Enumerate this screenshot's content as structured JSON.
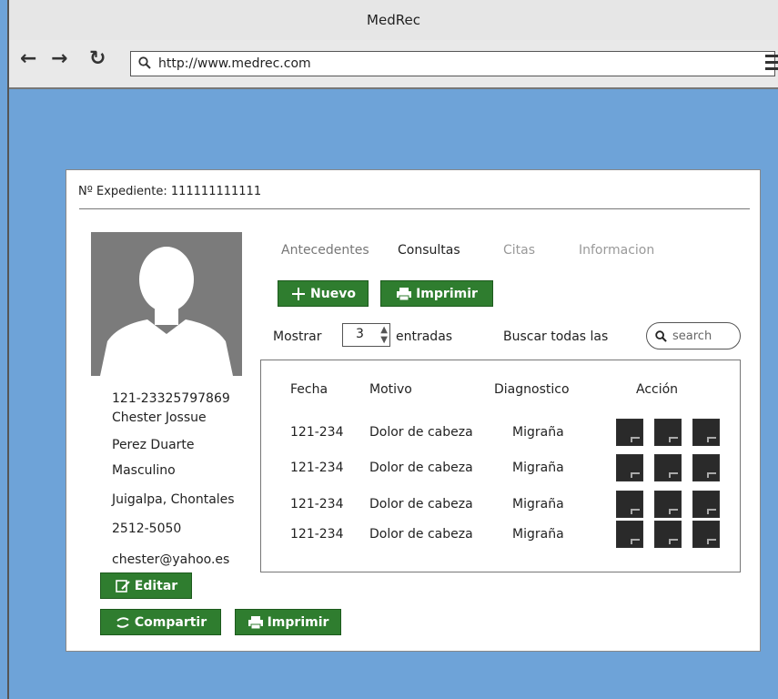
{
  "window": {
    "title": "MedRec"
  },
  "browser": {
    "url": "http://www.medrec.com"
  },
  "record": {
    "label": "Nº Expediente: 111111111111"
  },
  "patient": {
    "id": "121-23325797869",
    "first_name": "Chester Jossue",
    "last_name": "Perez Duarte",
    "gender": "Masculino",
    "location": "Juigalpa, Chontales",
    "phone": "2512-5050",
    "email": "chester@yahoo.es"
  },
  "buttons": {
    "edit": "Editar",
    "share": "Compartir",
    "print_patient": "Imprimir",
    "new": "Nuevo",
    "print_table": "Imprimir"
  },
  "tabs": [
    "Antecedentes",
    "Consultas",
    "Citas",
    "Informacion"
  ],
  "controls": {
    "show_label": "Mostrar",
    "entries_value": "3",
    "entries_label": "entradas",
    "search_label": "Buscar todas las",
    "search_placeholder": "search"
  },
  "table": {
    "headers": [
      "Fecha",
      "Motivo",
      "Diagnostico",
      "Acción"
    ],
    "rows": [
      [
        "121-234",
        "Dolor de cabeza",
        "Migraña"
      ],
      [
        "121-234",
        "Dolor de cabeza",
        "Migraña"
      ],
      [
        "121-234",
        "Dolor de cabeza",
        "Migraña"
      ],
      [
        "121-234",
        "Dolor de cabeza",
        "Migraña"
      ]
    ]
  },
  "colors": {
    "background": "#6ea3d8",
    "button": "#2f7d2f"
  }
}
